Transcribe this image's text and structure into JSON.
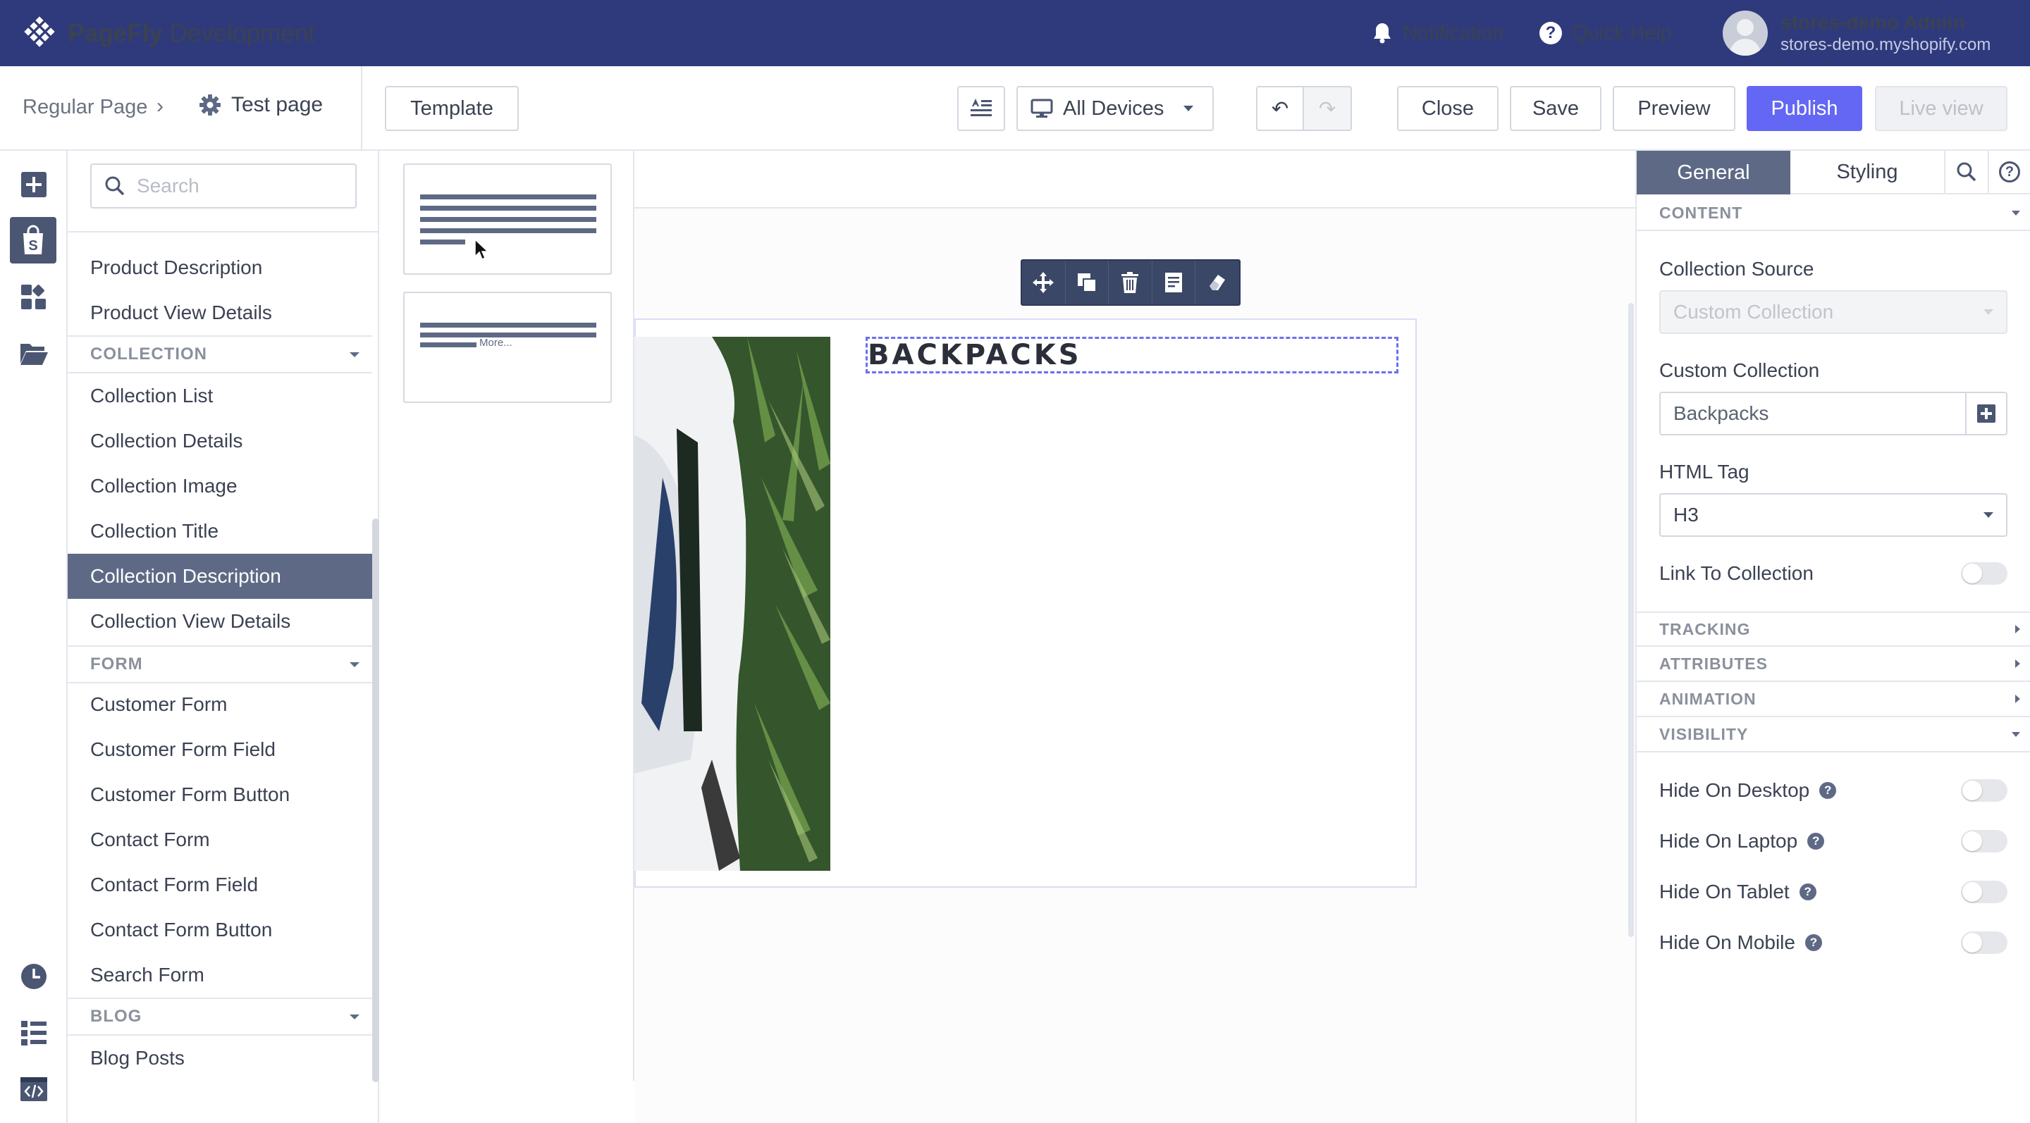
{
  "topbar": {
    "brand_bold": "PageFly",
    "brand_rest": " Development",
    "notification": "Notification",
    "quick_help": "Quick Help",
    "user_name": "stores-demo Admin",
    "user_store": "stores-demo.myshopify.com"
  },
  "toolbar": {
    "breadcrumb_page_type": "Regular Page",
    "breadcrumb_separator": "›",
    "page_name": "Test page",
    "template_label": "Template",
    "devices_label": "All Devices",
    "undo_icon": "↶",
    "redo_icon": "↷",
    "close_label": "Close",
    "save_label": "Save",
    "preview_label": "Preview",
    "publish_label": "Publish",
    "live_view_label": "Live view",
    "publish_color": "#6367f4"
  },
  "element_panel": {
    "search_placeholder": "Search",
    "top_items": [
      "Product Description",
      "Product View Details"
    ],
    "groups": {
      "collection": {
        "title": "COLLECTION",
        "items": [
          "Collection List",
          "Collection Details",
          "Collection Image",
          "Collection Title",
          "Collection Description",
          "Collection View Details"
        ],
        "active": "Collection Description"
      },
      "form": {
        "title": "FORM",
        "items": [
          "Customer Form",
          "Customer Form Field",
          "Customer Form Button",
          "Contact Form",
          "Contact Form Field",
          "Contact Form Button",
          "Search Form"
        ]
      },
      "blog": {
        "title": "BLOG",
        "items": [
          "Blog Posts"
        ]
      }
    }
  },
  "variants": {
    "more_label": "More..."
  },
  "canvas": {
    "heading_text": "BACKPACKS",
    "selection_color": "#6b6ff0"
  },
  "right_panel": {
    "tab_general": "General",
    "tab_styling": "Styling",
    "content_header": "CONTENT",
    "collection_source_label": "Collection Source",
    "collection_source_value": "Custom Collection",
    "custom_collection_label": "Custom Collection",
    "custom_collection_value": "Backpacks",
    "html_tag_label": "HTML Tag",
    "html_tag_value": "H3",
    "link_to_collection_label": "Link To Collection",
    "tracking_header": "TRACKING",
    "attributes_header": "ATTRIBUTES",
    "animation_header": "ANIMATION",
    "visibility_header": "VISIBILITY",
    "hide_desktop": "Hide On Desktop",
    "hide_laptop": "Hide On Laptop",
    "hide_tablet": "Hide On Tablet",
    "hide_mobile": "Hide On Mobile",
    "help_glyph": "?"
  }
}
